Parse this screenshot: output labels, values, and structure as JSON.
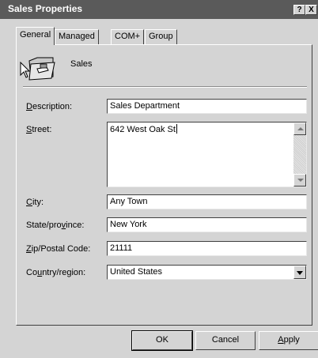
{
  "window": {
    "title": "Sales Properties",
    "help_label": "?",
    "close_label": "X"
  },
  "tabs": [
    {
      "label": "General",
      "active": true
    },
    {
      "label": "Managed By",
      "active": false
    },
    {
      "label": "COM+",
      "active": false
    },
    {
      "label": "Group Policy",
      "active": false
    }
  ],
  "object": {
    "name": "Sales",
    "icon": "organizational-unit-folder-icon"
  },
  "fields": {
    "description": {
      "label_u": "D",
      "label_rest": "escription:",
      "value": "Sales Department"
    },
    "street": {
      "label_u": "S",
      "label_rest": "treet:",
      "value": "642 West Oak St"
    },
    "city": {
      "label_u": "C",
      "label_rest": "ity:",
      "value": "Any Town"
    },
    "state": {
      "label_pre": "State/pro",
      "label_u": "v",
      "label_rest": "ince:",
      "value": "New York"
    },
    "zip": {
      "label_u": "Z",
      "label_rest": "ip/Postal Code:",
      "value": "21111"
    },
    "country": {
      "label_pre": "Co",
      "label_u": "u",
      "label_rest": "ntry/region:",
      "value": "United States"
    }
  },
  "buttons": {
    "ok": "OK",
    "cancel": "Cancel",
    "apply_u": "A",
    "apply_rest": "pply"
  }
}
